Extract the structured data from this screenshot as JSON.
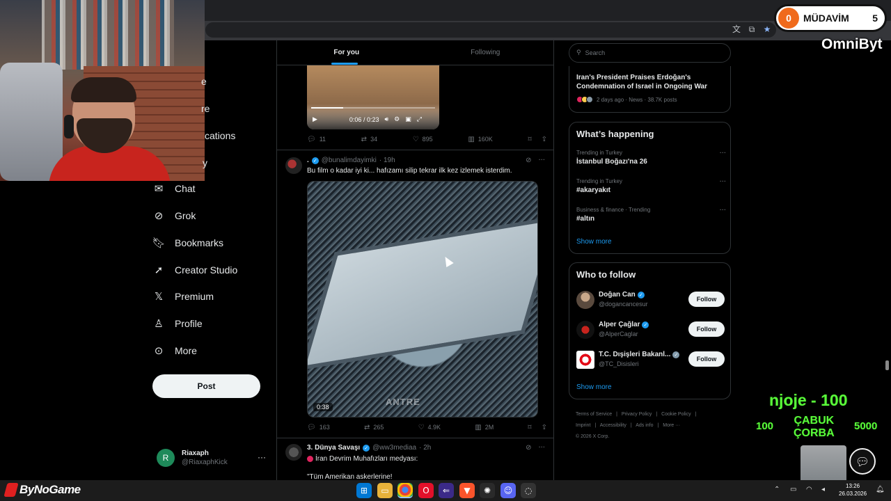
{
  "nav": {
    "partials": [
      "e",
      "re",
      "cations",
      "y"
    ],
    "items": [
      {
        "icon": "chat-icon",
        "label": "Chat"
      },
      {
        "icon": "grok-icon",
        "label": "Grok"
      },
      {
        "icon": "bookmark-icon",
        "label": "Bookmarks"
      },
      {
        "icon": "rocket-icon",
        "label": "Creator Studio"
      },
      {
        "icon": "x-logo-icon",
        "label": "Premium"
      },
      {
        "icon": "person-icon",
        "label": "Profile"
      },
      {
        "icon": "more-circle-icon",
        "label": "More"
      }
    ],
    "post_label": "Post"
  },
  "account": {
    "initial": "R",
    "name": "Riaxaph",
    "handle": "@RiaxaphKick",
    "more": "···"
  },
  "timeline": {
    "tabs": [
      {
        "label": "For you",
        "active": true
      },
      {
        "label": "Following",
        "active": false
      }
    ],
    "video_top": {
      "time": "0:06 / 0:23",
      "progress": 0.26
    },
    "tweet1_actions": {
      "replies": "11",
      "reposts": "34",
      "likes": "895",
      "views": "160K"
    },
    "tweet2": {
      "name": ".",
      "handle": "@bunalimdayimki",
      "time": "· 19h",
      "text": "Bu film o kadar iyi ki... hafızamı silip tekrar ilk kez izlemek isterdim.",
      "video_duration": "0:38",
      "video_watermark": "ANTRE",
      "actions": {
        "replies": "163",
        "reposts": "265",
        "likes": "4.9K",
        "views": "2M"
      }
    },
    "tweet3": {
      "name": "3. Dünya Savaşı",
      "handle": "@ww3mediaa",
      "time": "· 2h",
      "line1": "İran Devrim Muhafızları medyası:",
      "line2": "\"Tüm Amerikan askerlerine!"
    }
  },
  "sidebar": {
    "search_placeholder": "Search",
    "news": {
      "title": "Iran's President Praises Erdoğan's Condemnation of Israel in Ongoing War",
      "meta": "2 days ago · News · 38.7K posts"
    },
    "whats_happening": {
      "title": "What’s happening",
      "trends": [
        {
          "meta": "Trending in Turkey",
          "name": "İstanbul Boğazı'na 26"
        },
        {
          "meta": "Trending in Turkey",
          "name": "#akaryakıt"
        },
        {
          "meta": "Business & finance · Trending",
          "name": "#altın"
        }
      ],
      "show_more": "Show more"
    },
    "who_to_follow": {
      "title": "Who to follow",
      "accounts": [
        {
          "name": "Doğan Can",
          "handle": "@dogancancesur",
          "button": "Follow",
          "verified_color": "#1d9bf0"
        },
        {
          "name": "Alper Çağlar",
          "handle": "@AlperCaglar",
          "button": "Follow",
          "verified_color": "#1d9bf0"
        },
        {
          "name": "T.C. Dışişleri Bakanl...",
          "handle": "@TC_Disisleri",
          "button": "Follow",
          "verified_color": "#829aab"
        }
      ],
      "show_more": "Show more"
    },
    "footer": [
      "Terms of Service",
      "|",
      "Privacy Policy",
      "|",
      "Cookie Policy",
      "|",
      "Imprint",
      "|",
      "Accessibility",
      "|",
      "Ads info",
      "|",
      "More ···",
      "© 2026 X Corp."
    ]
  },
  "overlay": {
    "mudavim_zero": "0",
    "mudavim_label": "MÜDAVİM",
    "mudavim_count": "5",
    "channel": "OmniByt",
    "donation": "njoje - 100",
    "left_amount": "100",
    "reward_line1": "ÇABUK",
    "reward_line2": "ÇORBA",
    "right_amount": "5000"
  },
  "taskbar": {
    "brand": "ByNoGame",
    "time": "13:26",
    "date": "26.03.2026"
  },
  "colors": {
    "accent": "#1d9bf0",
    "background": "#000000",
    "border": "#2f3336",
    "overlay_green": "#5aff3a"
  }
}
